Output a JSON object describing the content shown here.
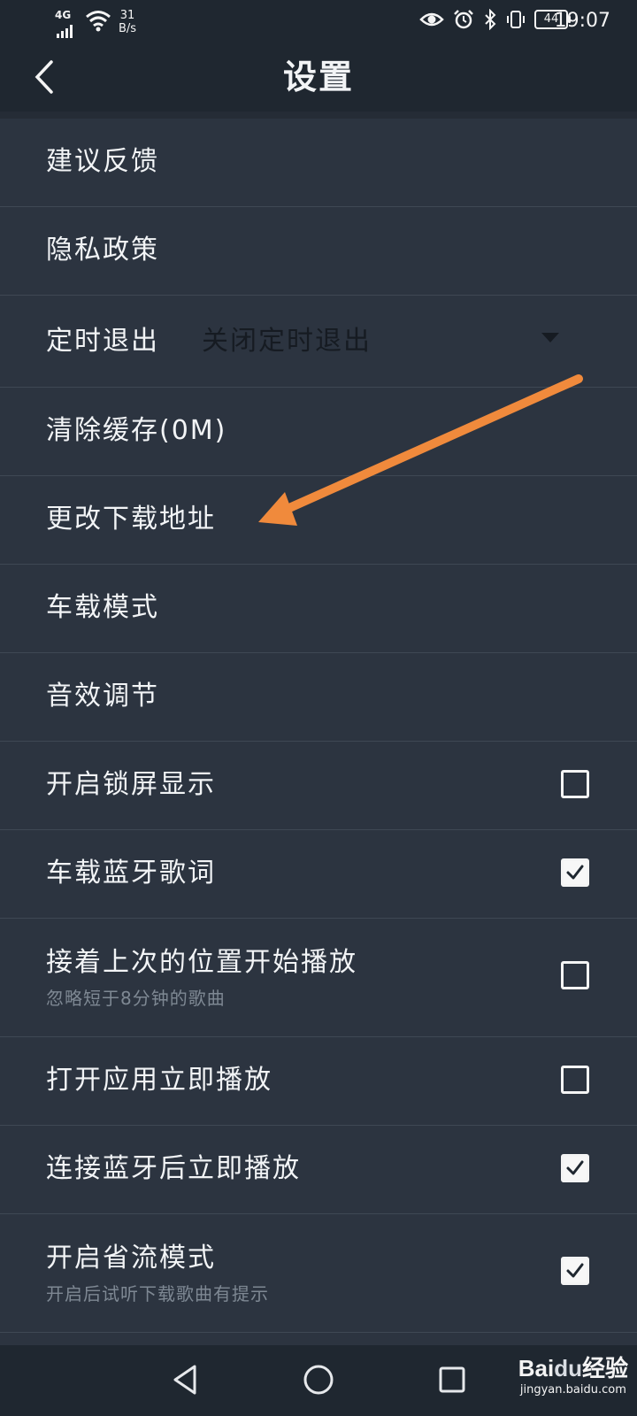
{
  "status_bar": {
    "network": "4G",
    "speed_value": "31",
    "speed_unit": "B/s",
    "battery": "44",
    "time": "19:07"
  },
  "header": {
    "title": "设置",
    "back_icon": "chevron-left-icon"
  },
  "settings": {
    "feedback": "建议反馈",
    "privacy": "隐私政策",
    "timer_label": "定时退出",
    "timer_value": "关闭定时退出",
    "clear_cache": "清除缓存(0M)",
    "change_download": "更改下载地址",
    "car_mode": "车载模式",
    "sound_effect": "音效调节",
    "lockscreen": {
      "label": "开启锁屏显示",
      "checked": false
    },
    "car_bt_lyrics": {
      "label": "车载蓝牙歌词",
      "checked": true
    },
    "resume_play": {
      "label": "接着上次的位置开始播放",
      "sub": "忽略短于8分钟的歌曲",
      "checked": false
    },
    "autoplay_open": {
      "label": "打开应用立即播放",
      "checked": false
    },
    "autoplay_bt": {
      "label": "连接蓝牙后立即播放",
      "checked": true
    },
    "data_saver": {
      "label": "开启省流模式",
      "sub": "开启后试听下载歌曲有提示",
      "checked": true
    }
  },
  "nav_bar": {
    "back": "triangle-back-icon",
    "home": "circle-home-icon",
    "recents": "square-recents-icon"
  },
  "watermark": {
    "logo_text": "Bai",
    "logo_du": "du",
    "logo_cn": "经验",
    "url": "jingyan.baidu.com"
  },
  "colors": {
    "background": "#2c3440",
    "bar": "#1f2730",
    "annotation_arrow": "#f08a3c"
  }
}
